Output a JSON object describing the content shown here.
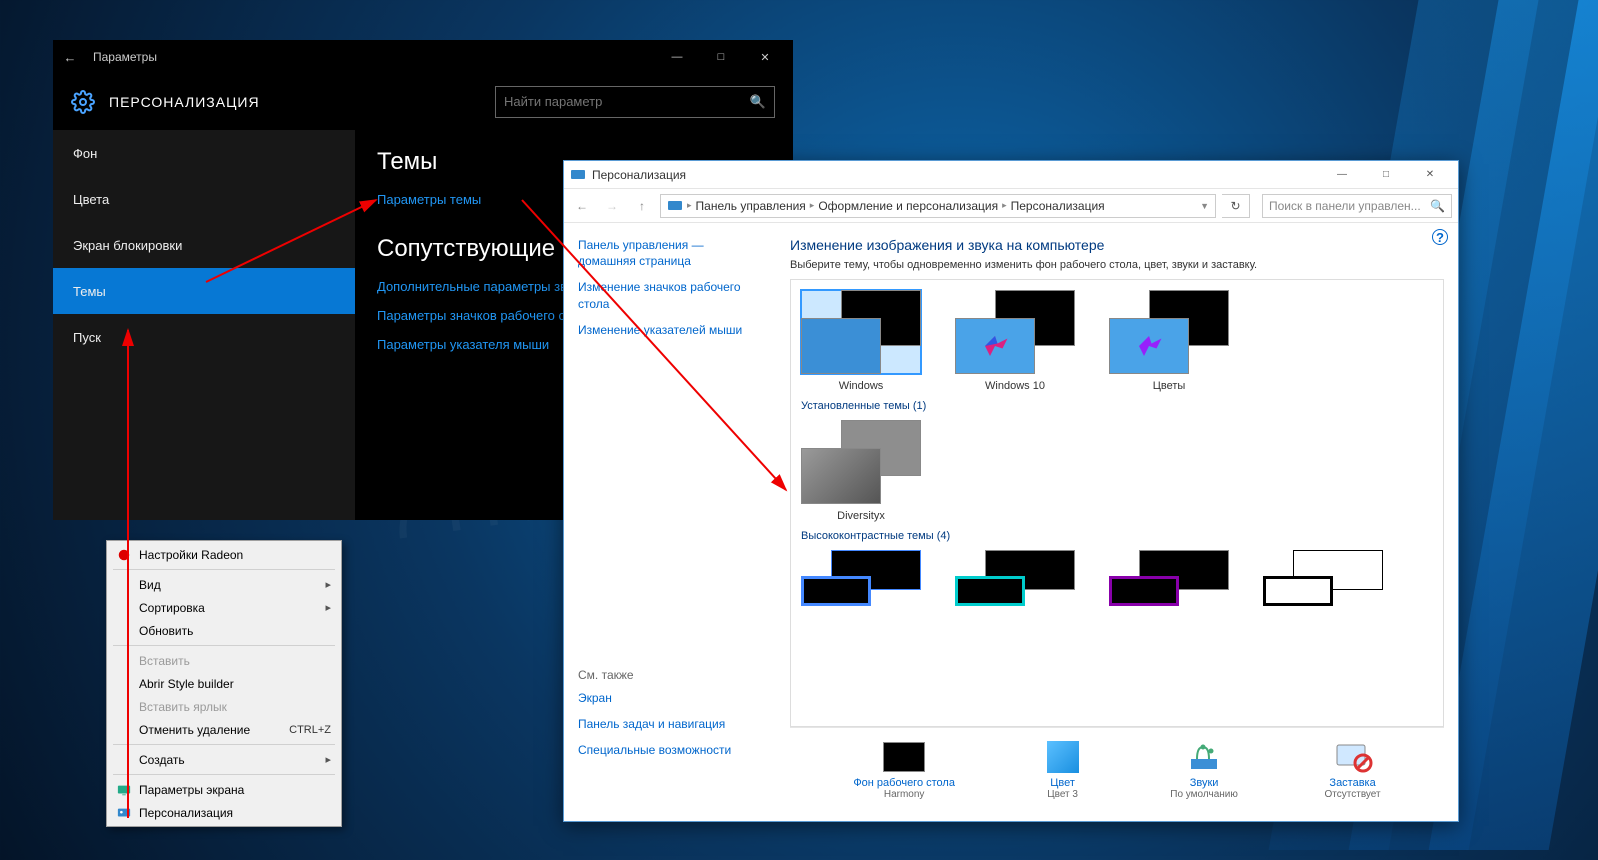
{
  "settings": {
    "titlebar": {
      "title": "Параметры"
    },
    "header": {
      "text": "ПЕРСОНАЛИЗАЦИЯ",
      "search_placeholder": "Найти параметр"
    },
    "nav": [
      {
        "label": "Фон"
      },
      {
        "label": "Цвета"
      },
      {
        "label": "Экран блокировки"
      },
      {
        "label": "Темы",
        "active": true
      },
      {
        "label": "Пуск"
      }
    ],
    "content": {
      "heading1": "Темы",
      "link1": "Параметры темы",
      "heading2": "Сопутствующие параметры",
      "link2": "Дополнительные параметры звука",
      "link3": "Параметры значков рабочего стола",
      "link4": "Параметры указателя мыши"
    }
  },
  "context_menu": {
    "items": [
      {
        "label": "Настройки Radeon",
        "icon": "radeon"
      },
      {
        "sep": true
      },
      {
        "label": "Вид",
        "submenu": true
      },
      {
        "label": "Сортировка",
        "submenu": true
      },
      {
        "label": "Обновить"
      },
      {
        "sep": true
      },
      {
        "label": "Вставить",
        "disabled": true
      },
      {
        "label": "Abrir Style builder"
      },
      {
        "label": "Вставить ярлык",
        "disabled": true
      },
      {
        "label": "Отменить удаление",
        "shortcut": "CTRL+Z"
      },
      {
        "sep": true
      },
      {
        "label": "Создать",
        "submenu": true
      },
      {
        "sep": true
      },
      {
        "label": "Параметры экрана",
        "icon": "display"
      },
      {
        "label": "Персонализация",
        "icon": "personalize"
      }
    ]
  },
  "cp": {
    "titlebar": {
      "title": "Персонализация"
    },
    "breadcrumbs": [
      "Панель управления",
      "Оформление и персонализация",
      "Персонализация"
    ],
    "search_placeholder": "Поиск в панели управлен...",
    "sidebar": {
      "links": [
        "Панель управления — домашняя страница",
        "Изменение значков рабочего стола",
        "Изменение указателей мыши"
      ],
      "see_also_header": "См. также",
      "see_also": [
        "Экран",
        "Панель задач и навигация",
        "Специальные возможности"
      ]
    },
    "main": {
      "heading": "Изменение изображения и звука на компьютере",
      "subtext": "Выберите тему, чтобы одновременно изменить фон рабочего стола, цвет, звуки и заставку.",
      "default_themes": [
        {
          "name": "Windows",
          "selected": true
        },
        {
          "name": "Windows 10"
        },
        {
          "name": "Цветы"
        }
      ],
      "installed_header": "Установленные темы (1)",
      "installed_themes": [
        {
          "name": "Diversityx"
        }
      ],
      "hc_header": "Высококонтрастные темы (4)"
    },
    "footer": {
      "items": [
        {
          "label": "Фон рабочего стола",
          "value": "Harmony",
          "icon": "desktop-bg"
        },
        {
          "label": "Цвет",
          "value": "Цвет 3",
          "icon": "color"
        },
        {
          "label": "Звуки",
          "value": "По умолчанию",
          "icon": "sounds"
        },
        {
          "label": "Заставка",
          "value": "Отсутствует",
          "icon": "screensaver"
        }
      ]
    }
  }
}
